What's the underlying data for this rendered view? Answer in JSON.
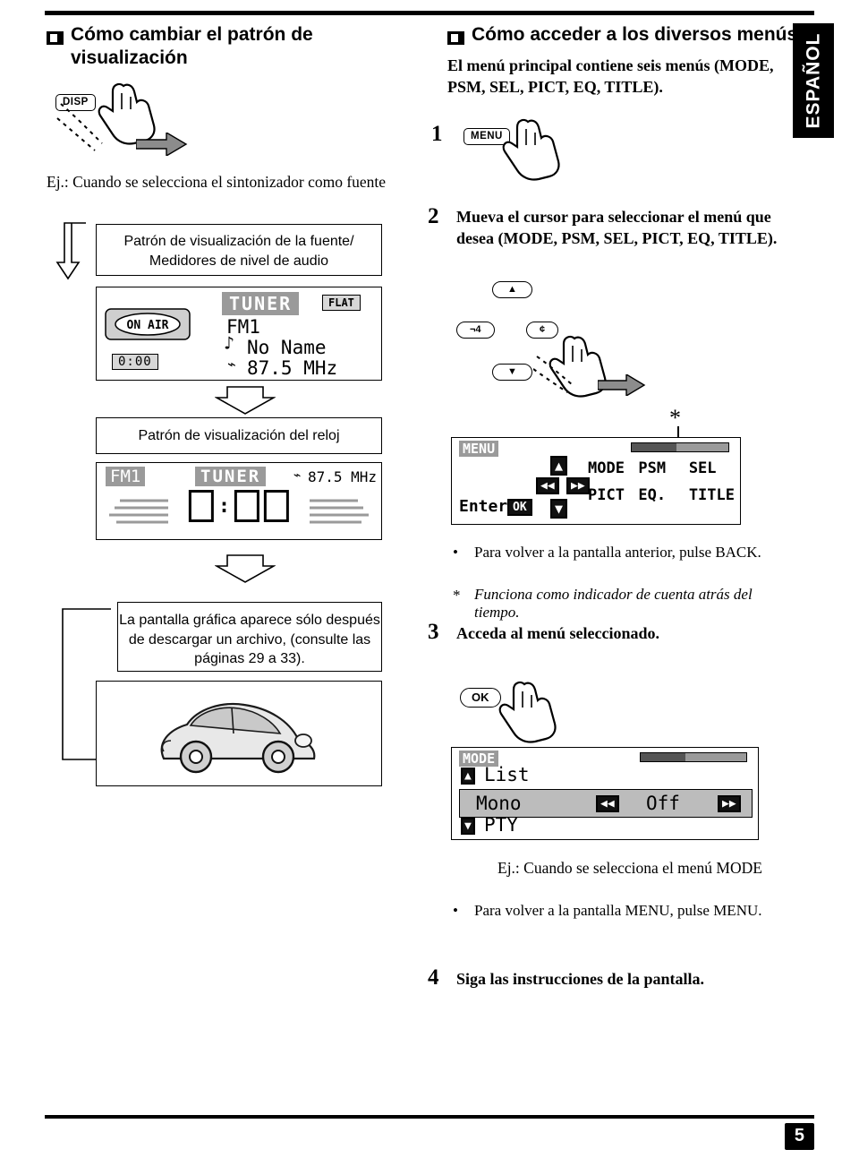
{
  "language_tab": "ESPAÑOL",
  "page_number": "5",
  "left": {
    "heading": "Cómo cambiar el patrón de visualización",
    "disp_button": "DISP",
    "example_label": "Ej.: Cuando se selecciona el sintonizador como fuente",
    "box_source": "Patrón de visualización de la fuente/ Medidores de nivel de audio",
    "lcd_tuner": {
      "title": "TUNER",
      "flat": "FLAT",
      "on_air": "ON AIR",
      "clock": "0:00",
      "band": "FM1",
      "name": "No Name",
      "freq": "87.5 MHz"
    },
    "box_clock": "Patrón de visualización del reloj",
    "lcd_clock": {
      "band": "FM1",
      "title": "TUNER",
      "freq": "87.5 MHz",
      "time": "0:00"
    },
    "box_graphic": "La pantalla gráfica aparece sólo después de descargar un archivo, (consulte las páginas 29 a 33)."
  },
  "right": {
    "heading": "Cómo acceder a los diversos menús",
    "intro": "El menú principal contiene seis menús (MODE, PSM, SEL, PICT, EQ, TITLE).",
    "step1_num": "1",
    "menu_button": "MENU",
    "step2_num": "2",
    "step2_text": "Mueva el cursor para seleccionar el menú que desea (MODE, PSM, SEL, PICT, EQ, TITLE).",
    "cursor_up": "▲",
    "cursor_down": "▼",
    "cursor_left": "¬4",
    "cursor_right": "¢",
    "star": "*",
    "lcd_menu": {
      "header": "MENU",
      "enter": "Enter",
      "enter_key": "OK",
      "items": [
        "MODE",
        "PSM",
        "SEL",
        "PICT",
        "EQ.",
        "TITLE"
      ]
    },
    "note_back": "Para volver a la pantalla anterior, pulse BACK.",
    "note_star": "Funciona como indicador de cuenta atrás del tiempo.",
    "note_star_mark": "*",
    "step3_num": "3",
    "step3_text": "Acceda al menú seleccionado.",
    "ok_button": "OK",
    "lcd_mode": {
      "header": "MODE",
      "row1": "List",
      "row2_label": "Mono",
      "row2_value": "Off",
      "row3": "PTY"
    },
    "mode_example": "Ej.: Cuando se selecciona el menú MODE",
    "note_menu": "Para volver a la pantalla MENU, pulse MENU.",
    "step4_num": "4",
    "step4_text": "Siga las instrucciones de la pantalla."
  }
}
